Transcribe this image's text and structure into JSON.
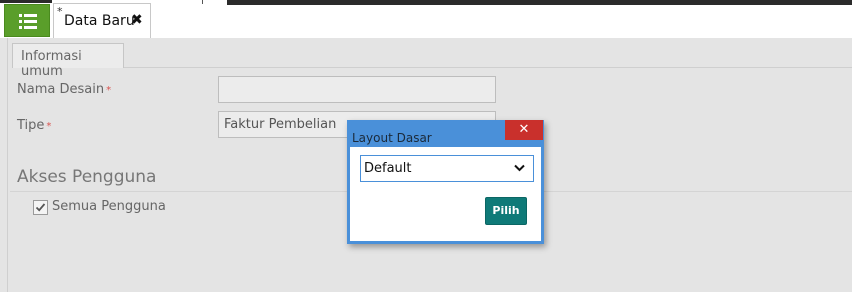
{
  "tabs": {
    "doc_tab_label": "Data Baru",
    "doc_tab_modified": "*",
    "doc_tab_close": "✖"
  },
  "section": {
    "tab_label": "Informasi umum"
  },
  "form": {
    "nama_desain_label": "Nama Desain",
    "nama_desain_value": "",
    "tipe_label": "Tipe",
    "tipe_value": "Faktur Pembelian",
    "required_mark": "*"
  },
  "access": {
    "heading": "Akses Pengguna",
    "all_users_label": "Semua Pengguna",
    "all_users_checked": true
  },
  "dialog": {
    "title": "Layout Dasar",
    "close_glyph": "✕",
    "select_value": "Default",
    "button_label": "Pilih"
  },
  "icons": {
    "menu": "list-icon",
    "close_tab": "close-icon",
    "check": "checkmark-icon",
    "select_arrow": "chevron-down-icon"
  },
  "colors": {
    "menu_green": "#5a9e2a",
    "dialog_blue": "#4a90d9",
    "close_red": "#c9302c",
    "button_teal": "#0f7a78",
    "required_red": "#d9534f"
  }
}
